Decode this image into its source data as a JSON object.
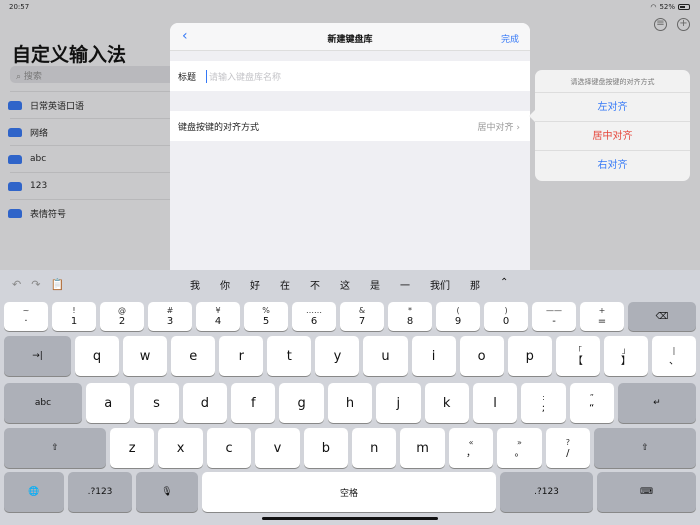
{
  "status": {
    "time": "20:57",
    "battery": "52%"
  },
  "sidebar": {
    "title": "自定义输入法",
    "search_placeholder": "搜索",
    "items": [
      "日常英语口语",
      "网络",
      "abc",
      "123",
      "表情符号"
    ]
  },
  "modal": {
    "back": "‹",
    "title": "新建键盘库",
    "done": "完成",
    "title_label": "标题",
    "title_placeholder": "请输入键盘库名称",
    "align_label": "键盘按键的对齐方式",
    "align_value": "居中对齐 ›"
  },
  "popover": {
    "header": "请选择键盘按键的对齐方式",
    "options": [
      "左对齐",
      "居中对齐",
      "右对齐"
    ],
    "selected_color": "#e5463a"
  },
  "keyboard": {
    "tools": [
      "↶",
      "↷",
      "📋"
    ],
    "suggestions": [
      "我",
      "你",
      "好",
      "在",
      "不",
      "这",
      "是",
      "一",
      "我们",
      "那",
      "⌃"
    ],
    "row1": [
      [
        "~",
        "·"
      ],
      [
        "!",
        "1"
      ],
      [
        "@",
        "2"
      ],
      [
        "#",
        "3"
      ],
      [
        "¥",
        "4"
      ],
      [
        "%",
        "5"
      ],
      [
        "……",
        "6"
      ],
      [
        "&",
        "7"
      ],
      [
        "*",
        "8"
      ],
      [
        "(",
        "9"
      ],
      [
        ")",
        "0"
      ],
      [
        "——",
        "-"
      ],
      [
        "+",
        "="
      ]
    ],
    "row2": [
      "q",
      "w",
      "e",
      "r",
      "t",
      "y",
      "u",
      "i",
      "o",
      "p",
      [
        "「",
        "【"
      ],
      [
        "」",
        "】"
      ],
      [
        "|",
        "、"
      ]
    ],
    "row3": [
      "a",
      "s",
      "d",
      "f",
      "g",
      "h",
      "j",
      "k",
      "l",
      [
        ":",
        ";"
      ],
      [
        "”",
        "“"
      ]
    ],
    "row4": [
      "z",
      "x",
      "c",
      "v",
      "b",
      "n",
      "m",
      [
        "«",
        "，"
      ],
      [
        "»",
        "。"
      ],
      [
        "?",
        "/"
      ]
    ],
    "delete": "⌫",
    "tab": "→|",
    "abc": "abc",
    "enter": "↵",
    "shift": "⇧",
    "globe": "🌐",
    "num": ".?123",
    "mic": "🎙",
    "space": "空格",
    "hide": "⌨"
  }
}
